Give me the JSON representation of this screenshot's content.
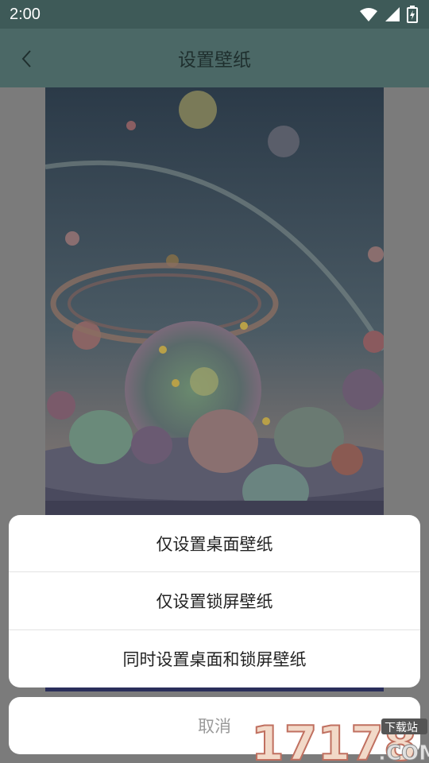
{
  "status_bar": {
    "time": "2:00"
  },
  "header": {
    "title": "设置壁纸"
  },
  "sheet": {
    "options": [
      {
        "label": "仅设置桌面壁纸"
      },
      {
        "label": "仅设置锁屏壁纸"
      },
      {
        "label": "同时设置桌面和锁屏壁纸"
      }
    ],
    "cancel_label": "取消"
  },
  "watermark": {
    "number": "17178",
    "tag": "下载站",
    "suffix": ".COM"
  },
  "colors": {
    "status_bar": "#3e5a58",
    "app_bar": "#4b6866",
    "dim_background": "#7b7b7b"
  }
}
